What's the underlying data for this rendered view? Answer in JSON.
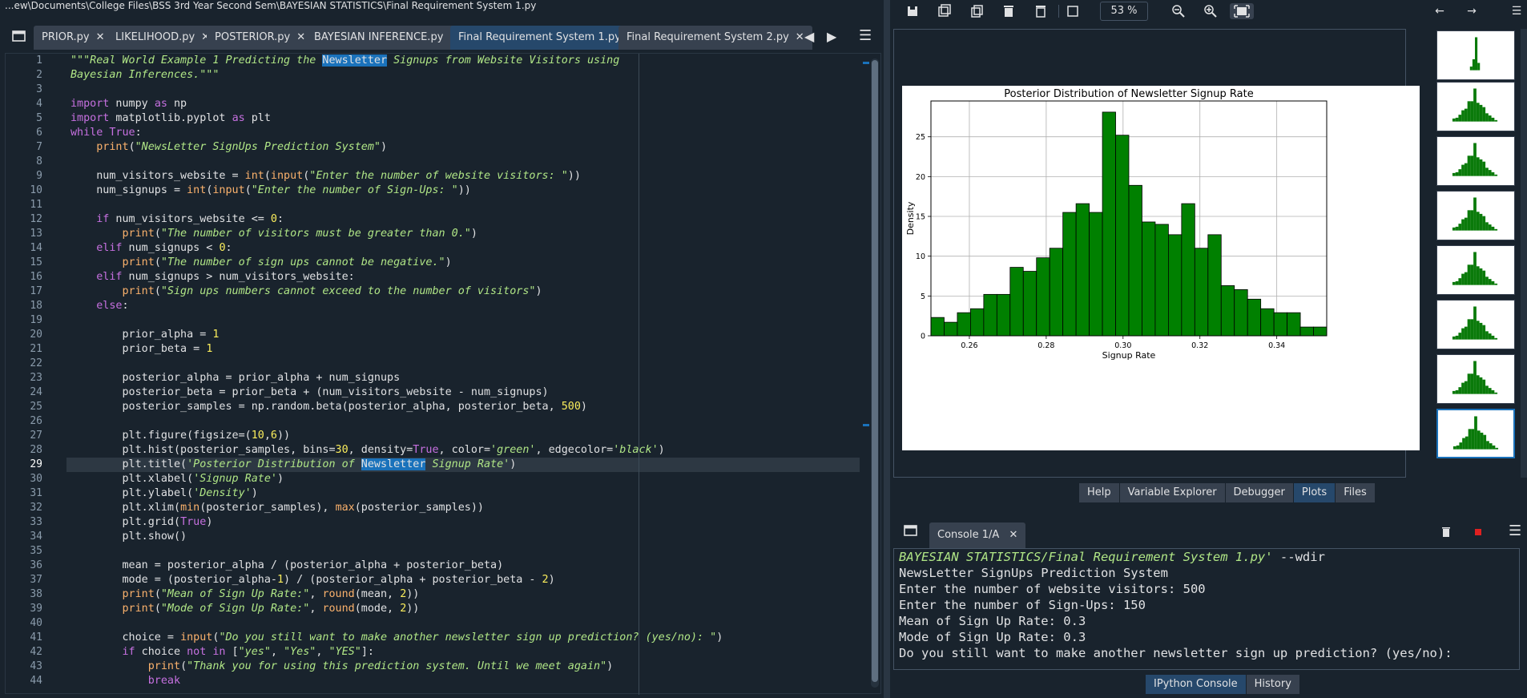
{
  "path": "...ew\\Documents\\College Files\\BSS 3rd Year Second Sem\\BAYESIAN STATISTICS\\Final Requirement System 1.py",
  "editor_tabs": [
    {
      "label": "PRIOR.py",
      "close": "✕"
    },
    {
      "label": "LIKELIHOOD.py",
      "close": "✕"
    },
    {
      "label": "POSTERIOR.py",
      "close": "✕"
    },
    {
      "label": "BAYESIAN INFERENCE.py",
      "close": "✕"
    },
    {
      "label": "Final Requirement System 1.py",
      "close": "✕"
    },
    {
      "label": "Final Requirement System 2.py",
      "close": "✕"
    }
  ],
  "active_tab": "Final Requirement System 1.py",
  "current_line": 29,
  "code_lines": [
    [
      [
        "s",
        "\"\"\"Real World Example 1 Predicting the "
      ],
      [
        "hl",
        "Newsletter"
      ],
      [
        "s",
        " Signups from Website Visitors using"
      ]
    ],
    [
      [
        "s",
        "Bayesian Inferences.\"\"\""
      ]
    ],
    [],
    [
      [
        "k",
        "import"
      ],
      [
        "t",
        " numpy "
      ],
      [
        "k",
        "as"
      ],
      [
        "t",
        " np"
      ]
    ],
    [
      [
        "k",
        "import"
      ],
      [
        "t",
        " matplotlib.pyplot "
      ],
      [
        "k",
        "as"
      ],
      [
        "t",
        " plt"
      ]
    ],
    [
      [
        "k",
        "while"
      ],
      [
        "t",
        " "
      ],
      [
        "k",
        "True"
      ],
      [
        "t",
        ":"
      ]
    ],
    [
      [
        "t",
        "    "
      ],
      [
        "b",
        "print"
      ],
      [
        "t",
        "("
      ],
      [
        "s",
        "\"NewsLetter SignUps Prediction System\""
      ],
      [
        "t",
        ")"
      ]
    ],
    [],
    [
      [
        "t",
        "    num_visitors_website = "
      ],
      [
        "b",
        "int"
      ],
      [
        "t",
        "("
      ],
      [
        "b",
        "input"
      ],
      [
        "t",
        "("
      ],
      [
        "s",
        "\"Enter the number of website visitors: \""
      ],
      [
        "t",
        "))"
      ]
    ],
    [
      [
        "t",
        "    num_signups = "
      ],
      [
        "b",
        "int"
      ],
      [
        "t",
        "("
      ],
      [
        "b",
        "input"
      ],
      [
        "t",
        "("
      ],
      [
        "s",
        "\"Enter the number of Sign-Ups: \""
      ],
      [
        "t",
        "))"
      ]
    ],
    [],
    [
      [
        "t",
        "    "
      ],
      [
        "k",
        "if"
      ],
      [
        "t",
        " num_visitors_website <= "
      ],
      [
        "n",
        "0"
      ],
      [
        "t",
        ":"
      ]
    ],
    [
      [
        "t",
        "        "
      ],
      [
        "b",
        "print"
      ],
      [
        "t",
        "("
      ],
      [
        "s",
        "\"The number of visitors must be greater than 0.\""
      ],
      [
        "t",
        ")"
      ]
    ],
    [
      [
        "t",
        "    "
      ],
      [
        "k",
        "elif"
      ],
      [
        "t",
        " num_signups < "
      ],
      [
        "n",
        "0"
      ],
      [
        "t",
        ":"
      ]
    ],
    [
      [
        "t",
        "        "
      ],
      [
        "b",
        "print"
      ],
      [
        "t",
        "("
      ],
      [
        "s",
        "\"The number of sign ups cannot be negative.\""
      ],
      [
        "t",
        ")"
      ]
    ],
    [
      [
        "t",
        "    "
      ],
      [
        "k",
        "elif"
      ],
      [
        "t",
        " num_signups > num_visitors_website:"
      ]
    ],
    [
      [
        "t",
        "        "
      ],
      [
        "b",
        "print"
      ],
      [
        "t",
        "("
      ],
      [
        "s",
        "\"Sign ups numbers cannot exceed to the number of visitors\""
      ],
      [
        "t",
        ")"
      ]
    ],
    [
      [
        "t",
        "    "
      ],
      [
        "k",
        "else"
      ],
      [
        "t",
        ":"
      ]
    ],
    [],
    [
      [
        "t",
        "        prior_alpha = "
      ],
      [
        "n",
        "1"
      ]
    ],
    [
      [
        "t",
        "        prior_beta = "
      ],
      [
        "n",
        "1"
      ]
    ],
    [],
    [
      [
        "t",
        "        posterior_alpha = prior_alpha + num_signups"
      ]
    ],
    [
      [
        "t",
        "        posterior_beta = prior_beta + (num_visitors_website - num_signups)"
      ]
    ],
    [
      [
        "t",
        "        posterior_samples = np.random.beta(posterior_alpha, posterior_beta, "
      ],
      [
        "n",
        "500"
      ],
      [
        "t",
        ")"
      ]
    ],
    [],
    [
      [
        "t",
        "        plt.figure(figsize=("
      ],
      [
        "n",
        "10"
      ],
      [
        "t",
        ","
      ],
      [
        "n",
        "6"
      ],
      [
        "t",
        "))"
      ]
    ],
    [
      [
        "t",
        "        plt.hist(posterior_samples, bins="
      ],
      [
        "n",
        "30"
      ],
      [
        "t",
        ", density="
      ],
      [
        "k",
        "True"
      ],
      [
        "t",
        ", color="
      ],
      [
        "s",
        "'green'"
      ],
      [
        "t",
        ", edgecolor="
      ],
      [
        "s",
        "'black'"
      ],
      [
        "t",
        ")"
      ]
    ],
    [
      [
        "t",
        "        plt.title("
      ],
      [
        "s",
        "'Posterior Distribution of "
      ],
      [
        "hl",
        "Newsletter"
      ],
      [
        "s",
        " Signup Rate'"
      ],
      [
        "t",
        ")"
      ]
    ],
    [
      [
        "t",
        "        plt.xlabel("
      ],
      [
        "s",
        "'Signup Rate'"
      ],
      [
        "t",
        ")"
      ]
    ],
    [
      [
        "t",
        "        plt.ylabel("
      ],
      [
        "s",
        "'Density'"
      ],
      [
        "t",
        ")"
      ]
    ],
    [
      [
        "t",
        "        plt.xlim("
      ],
      [
        "b",
        "min"
      ],
      [
        "t",
        "(posterior_samples), "
      ],
      [
        "b",
        "max"
      ],
      [
        "t",
        "(posterior_samples))"
      ]
    ],
    [
      [
        "t",
        "        plt.grid("
      ],
      [
        "k",
        "True"
      ],
      [
        "t",
        ")"
      ]
    ],
    [
      [
        "t",
        "        plt.show()"
      ]
    ],
    [],
    [
      [
        "t",
        "        mean = posterior_alpha / (posterior_alpha + posterior_beta)"
      ]
    ],
    [
      [
        "t",
        "        mode = (posterior_alpha-"
      ],
      [
        "n",
        "1"
      ],
      [
        "t",
        ") / (posterior_alpha + posterior_beta - "
      ],
      [
        "n",
        "2"
      ],
      [
        "t",
        ")"
      ]
    ],
    [
      [
        "t",
        "        "
      ],
      [
        "b",
        "print"
      ],
      [
        "t",
        "("
      ],
      [
        "s",
        "\"Mean of Sign Up Rate:\""
      ],
      [
        "t",
        ", "
      ],
      [
        "b",
        "round"
      ],
      [
        "t",
        "(mean, "
      ],
      [
        "n",
        "2"
      ],
      [
        "t",
        "))"
      ]
    ],
    [
      [
        "t",
        "        "
      ],
      [
        "b",
        "print"
      ],
      [
        "t",
        "("
      ],
      [
        "s",
        "\"Mode of Sign Up Rate:\""
      ],
      [
        "t",
        ", "
      ],
      [
        "b",
        "round"
      ],
      [
        "t",
        "(mode, "
      ],
      [
        "n",
        "2"
      ],
      [
        "t",
        "))"
      ]
    ],
    [],
    [
      [
        "t",
        "        choice = "
      ],
      [
        "b",
        "input"
      ],
      [
        "t",
        "("
      ],
      [
        "s",
        "\"Do you still want to make another newsletter sign up prediction? (yes/no): \""
      ],
      [
        "t",
        ")"
      ]
    ],
    [
      [
        "t",
        "        "
      ],
      [
        "k",
        "if"
      ],
      [
        "t",
        " choice "
      ],
      [
        "k",
        "not in"
      ],
      [
        "t",
        " ["
      ],
      [
        "s",
        "\"yes\""
      ],
      [
        "t",
        ", "
      ],
      [
        "s",
        "\"Yes\""
      ],
      [
        "t",
        ", "
      ],
      [
        "s",
        "\"YES\""
      ],
      [
        "t",
        "]:"
      ]
    ],
    [
      [
        "t",
        "            "
      ],
      [
        "b",
        "print"
      ],
      [
        "t",
        "("
      ],
      [
        "s",
        "\"Thank you for using this prediction system. Until we meet again\""
      ],
      [
        "t",
        ")"
      ]
    ],
    [
      [
        "t",
        "            "
      ],
      [
        "k",
        "break"
      ]
    ]
  ],
  "plot_toolbar": {
    "zoom": "53 %"
  },
  "plot_tabs": [
    "Help",
    "Variable Explorer",
    "Debugger",
    "Plots",
    "Files"
  ],
  "active_plot_tab": "Plots",
  "console_tab": {
    "label": "Console 1/A",
    "close": "✕"
  },
  "console_lines": [
    {
      "parts": [
        [
          "s",
          "BAYESIAN STATISTICS/Final Requirement System 1.py'"
        ],
        [
          "t",
          " --wdir"
        ]
      ]
    },
    {
      "parts": [
        [
          "t",
          "NewsLetter SignUps Prediction System"
        ]
      ]
    },
    {
      "parts": [
        [
          "t",
          "Enter the number of website visitors: 500"
        ]
      ]
    },
    {
      "parts": [
        [
          "t",
          "Enter the number of Sign-Ups: 150"
        ]
      ]
    },
    {
      "parts": [
        [
          "t",
          "Mean of Sign Up Rate: 0.3"
        ]
      ]
    },
    {
      "parts": [
        [
          "t",
          "Mode of Sign Up Rate: 0.3"
        ]
      ]
    },
    {
      "parts": [
        [
          "t",
          "Do you still want to make another newsletter sign up prediction? (yes/no):"
        ]
      ]
    }
  ],
  "console_tabs": [
    "IPython Console",
    "History"
  ],
  "active_console_tab": "IPython Console",
  "chart_data": {
    "type": "bar",
    "title": "Posterior Distribution of Newsletter Signup Rate",
    "xlabel": "Signup Rate",
    "ylabel": "Density",
    "xlim": [
      0.25,
      0.353
    ],
    "ylim": [
      0,
      29.5
    ],
    "xticks": [
      "0.26",
      "0.28",
      "0.30",
      "0.32",
      "0.34"
    ],
    "xtick_values": [
      0.26,
      0.28,
      0.3,
      0.32,
      0.34
    ],
    "yticks": [
      "0",
      "5",
      "10",
      "15",
      "20",
      "25"
    ],
    "ytick_values": [
      0,
      5,
      10,
      15,
      20,
      25
    ],
    "grid": true,
    "bar_color": "#008000",
    "edge_color": "#000000",
    "values": [
      2.3,
      1.7,
      2.9,
      3.4,
      5.2,
      5.2,
      8.6,
      8.1,
      9.8,
      11.0,
      15.5,
      16.6,
      15.5,
      28.1,
      25.2,
      18.9,
      14.3,
      14.0,
      12.7,
      16.6,
      11.0,
      12.7,
      6.3,
      5.8,
      4.6,
      3.4,
      2.9,
      2.9,
      1.1,
      1.1
    ]
  }
}
